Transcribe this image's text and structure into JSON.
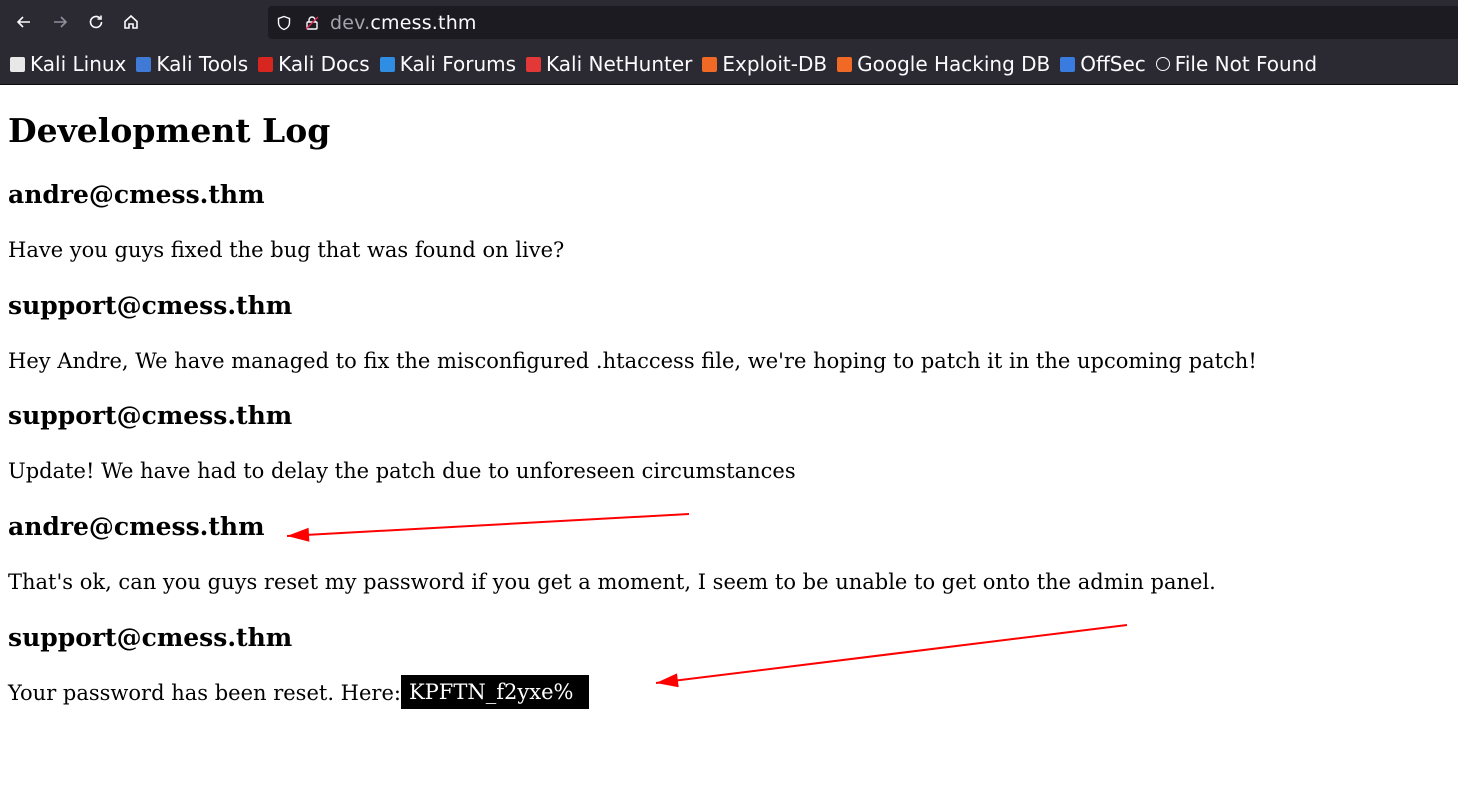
{
  "browser": {
    "url_subdomain": "dev.",
    "url_domain": "cmess.thm",
    "bookmarks": [
      {
        "label": "Kali Linux",
        "icon": "kali-dragon-icon",
        "color": "#e8e8e8"
      },
      {
        "label": "Kali Tools",
        "icon": "kali-tools-icon",
        "color": "#3f7bd6"
      },
      {
        "label": "Kali Docs",
        "icon": "kali-docs-icon",
        "color": "#d7261f"
      },
      {
        "label": "Kali Forums",
        "icon": "kali-forums-icon",
        "color": "#2f8de4"
      },
      {
        "label": "Kali NetHunter",
        "icon": "kali-nethunter-icon",
        "color": "#e23838"
      },
      {
        "label": "Exploit-DB",
        "icon": "exploit-db-icon",
        "color": "#f06a25"
      },
      {
        "label": "Google Hacking DB",
        "icon": "ghdb-icon",
        "color": "#f06a25"
      },
      {
        "label": "OffSec",
        "icon": "offsec-icon",
        "color": "#3a7be0"
      },
      {
        "label": "File Not Found",
        "icon": "globe-icon",
        "color": "#fbfbfe"
      }
    ]
  },
  "page": {
    "title": "Development Log",
    "entries": [
      {
        "author": "andre@cmess.thm",
        "message": "Have you guys fixed the bug that was found on live?"
      },
      {
        "author": "support@cmess.thm",
        "message": "Hey Andre, We have managed to fix the misconfigured .htaccess file, we're hoping to patch it in the upcoming patch!"
      },
      {
        "author": "support@cmess.thm",
        "message": "Update! We have had to delay the patch due to unforeseen circumstances"
      },
      {
        "author": "andre@cmess.thm",
        "message": "That's ok, can you guys reset my password if you get a moment, I seem to be unable to get onto the admin panel."
      },
      {
        "author": "support@cmess.thm",
        "message": "Your password has been reset. Here:",
        "secret": "KPFTN_f2yxe%"
      }
    ]
  },
  "annotation_color": "#ff0000"
}
